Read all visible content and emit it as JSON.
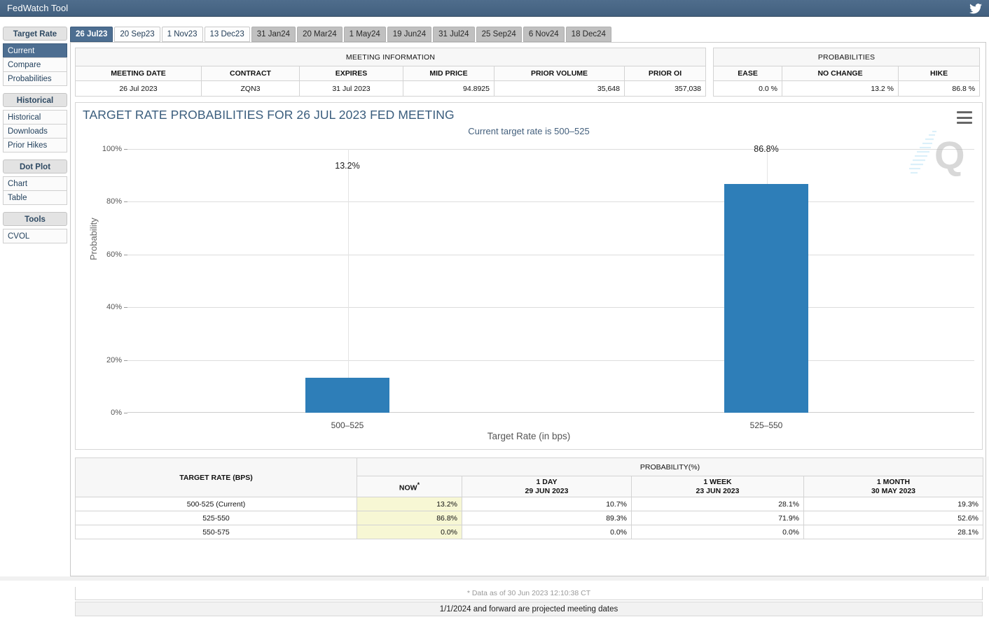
{
  "window": {
    "title": "FedWatch Tool",
    "twitter_icon": "twitter-bird-icon"
  },
  "sidebar": {
    "groups": [
      {
        "title": "Target Rate",
        "items": [
          {
            "label": "Current",
            "active": true
          },
          {
            "label": "Compare",
            "active": false
          },
          {
            "label": "Probabilities",
            "active": false
          }
        ]
      },
      {
        "title": "Historical",
        "items": [
          {
            "label": "Historical",
            "active": false
          },
          {
            "label": "Downloads",
            "active": false
          },
          {
            "label": "Prior Hikes",
            "active": false
          }
        ]
      },
      {
        "title": "Dot Plot",
        "items": [
          {
            "label": "Chart",
            "active": false
          },
          {
            "label": "Table",
            "active": false
          }
        ]
      },
      {
        "title": "Tools",
        "items": [
          {
            "label": "CVOL",
            "active": false
          }
        ]
      }
    ]
  },
  "tabs": [
    {
      "label": "26 Jul23",
      "state": "active"
    },
    {
      "label": "20 Sep23",
      "state": "normal"
    },
    {
      "label": "1 Nov23",
      "state": "normal"
    },
    {
      "label": "13 Dec23",
      "state": "normal"
    },
    {
      "label": "31 Jan24",
      "state": "dim"
    },
    {
      "label": "20 Mar24",
      "state": "dim"
    },
    {
      "label": "1 May24",
      "state": "dim"
    },
    {
      "label": "19 Jun24",
      "state": "dim"
    },
    {
      "label": "31 Jul24",
      "state": "dim"
    },
    {
      "label": "25 Sep24",
      "state": "dim"
    },
    {
      "label": "6 Nov24",
      "state": "dim"
    },
    {
      "label": "18 Dec24",
      "state": "dim"
    }
  ],
  "meeting_information": {
    "band": "MEETING INFORMATION",
    "headers": [
      "MEETING DATE",
      "CONTRACT",
      "EXPIRES",
      "MID PRICE",
      "PRIOR VOLUME",
      "PRIOR OI"
    ],
    "row": {
      "meeting_date": "26 Jul 2023",
      "contract": "ZQN3",
      "expires": "31 Jul 2023",
      "mid_price": "94.8925",
      "prior_volume": "35,648",
      "prior_oi": "357,038"
    }
  },
  "probabilities_summary": {
    "band": "PROBABILITIES",
    "headers": [
      "EASE",
      "NO CHANGE",
      "HIKE"
    ],
    "row": {
      "ease": "0.0 %",
      "no_change": "13.2 %",
      "hike": "86.8 %"
    }
  },
  "chart_card": {
    "title": "TARGET RATE PROBABILITIES FOR 26 JUL 2023 FED MEETING",
    "subtitle": "Current target rate is 500–525",
    "menu_icon": "hamburger-menu-icon",
    "watermark": "quandl-q-watermark"
  },
  "chart_data": {
    "type": "bar",
    "title": "TARGET RATE PROBABILITIES FOR 26 JUL 2023 FED MEETING",
    "subtitle": "Current target rate is 500–525",
    "categories": [
      "500–525",
      "525–550"
    ],
    "values": [
      13.2,
      86.8
    ],
    "data_labels": [
      "13.2%",
      "86.8%"
    ],
    "xlabel": "Target Rate (in bps)",
    "ylabel": "Probability",
    "ylim": [
      0,
      100
    ],
    "yticks": [
      0,
      20,
      40,
      60,
      80,
      100
    ],
    "ytick_labels": [
      "0%",
      "20%",
      "40%",
      "60%",
      "80%",
      "100%"
    ],
    "grid": true,
    "legend": false,
    "bar_color": "#2e7eb8"
  },
  "probability_table": {
    "band": "PROBABILITY(%)",
    "row_header": "TARGET RATE (BPS)",
    "columns": [
      {
        "line1": "NOW",
        "line2": "",
        "star": "*"
      },
      {
        "line1": "1 DAY",
        "line2": "29 JUN 2023",
        "star": ""
      },
      {
        "line1": "1 WEEK",
        "line2": "23 JUN 2023",
        "star": ""
      },
      {
        "line1": "1 MONTH",
        "line2": "30 MAY 2023",
        "star": ""
      }
    ],
    "rows": [
      {
        "rate": "500-525 (Current)",
        "now": "13.2%",
        "day": "10.7%",
        "week": "28.1%",
        "month": "19.3%"
      },
      {
        "rate": "525-550",
        "now": "86.8%",
        "day": "89.3%",
        "week": "71.9%",
        "month": "52.6%"
      },
      {
        "rate": "550-575",
        "now": "0.0%",
        "day": "0.0%",
        "week": "0.0%",
        "month": "28.1%"
      }
    ]
  },
  "footnote": "* Data as of 30 Jun 2023 12:10:38 CT",
  "projection_note": "1/1/2024 and forward are projected meeting dates",
  "colors": {
    "accent": "#4d6e91",
    "bar": "#2e7eb8",
    "highlight": "#f7f7d4"
  }
}
